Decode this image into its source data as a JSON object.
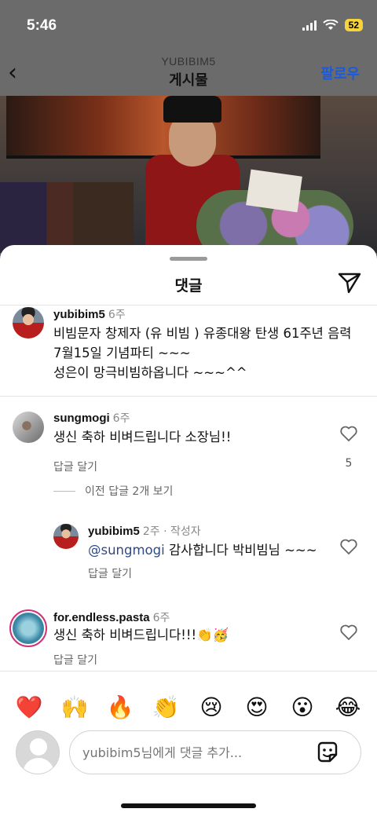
{
  "status_bar": {
    "time": "5:46",
    "battery": "52"
  },
  "nav": {
    "username": "YUBIBIM5",
    "title": "게시물",
    "follow_label": "팔로우"
  },
  "sheet": {
    "title": "댓글"
  },
  "comments": [
    {
      "username": "yubibim5",
      "time": "6주",
      "lines": [
        "비빔문자 창제자 (유 비빔 )  유종대왕 탄생 61주년 음력",
        "7월15일  기념파티 ~~~",
        "성은이 망극비빔하옵니다 ~~~^^"
      ]
    },
    {
      "username": "sungmogi",
      "time": "6주",
      "text": "생신 축하 비벼드립니다 소장님!!",
      "reply_label": "답글 달기",
      "likes": "5",
      "view_replies": "이전 답글 2개 보기"
    },
    {
      "username": "yubibim5",
      "time": "2주 · 작성자",
      "mention": "@sungmogi",
      "text": " 감사합니다  박비빔님 ~~~",
      "reply_label": "답글 달기"
    },
    {
      "username": "for.endless.pasta",
      "time": "6주",
      "text": "생신 축하 비벼드립니다!!!👏🥳",
      "reply_label": "답글 달기"
    }
  ],
  "emoji_bar": [
    {
      "glyph": "❤️",
      "name": "red-heart"
    },
    {
      "glyph": "🙌",
      "name": "raising-hands"
    },
    {
      "glyph": "🔥",
      "name": "fire"
    },
    {
      "glyph": "👏",
      "name": "clapping-hands"
    },
    {
      "glyph": "😢",
      "name": "crying-face"
    },
    {
      "glyph": "😍",
      "name": "heart-eyes"
    },
    {
      "glyph": "😮",
      "name": "open-mouth"
    },
    {
      "glyph": "😂",
      "name": "tears-of-joy"
    }
  ],
  "composer": {
    "placeholder": "yubibim5님에게 댓글 추가..."
  },
  "colors": {
    "accent": "#1d5bd6",
    "mention": "#2f4a86",
    "story_ring": "#d3307a"
  }
}
